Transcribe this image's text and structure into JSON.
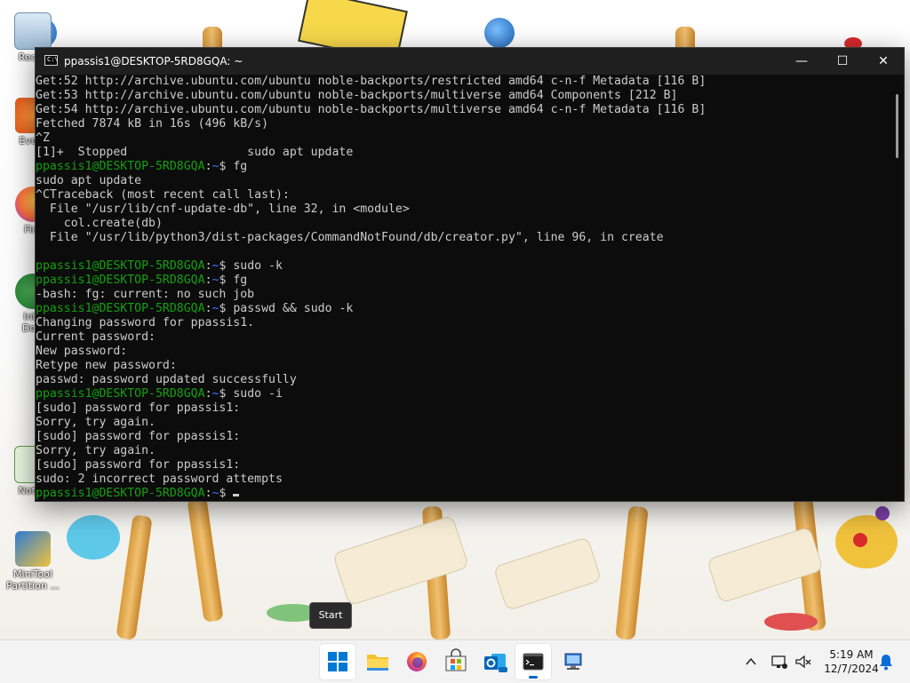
{
  "desktop": {
    "icons": [
      {
        "label": "Recycle Bin",
        "visible_label": "Recyc",
        "icon": "recycle-bin-icon"
      },
      {
        "label": "Everything",
        "visible_label": "Every",
        "icon": "everything-icon"
      },
      {
        "label": "Firefox",
        "visible_label": "Fire",
        "icon": "firefox-icon"
      },
      {
        "label": "Internet Download",
        "visible_label": "Inte\nDow",
        "icon": "internet-download-manager-icon"
      },
      {
        "label": "Notepad",
        "visible_label": "Notep",
        "icon": "notepad-icon"
      },
      {
        "label": "MiniTool Partition ...",
        "visible_label": "MiniTool\nPartition ...",
        "icon": "minitool-partition-icon"
      }
    ]
  },
  "window": {
    "title": "ppassis1@DESKTOP-5RD8GQA: ~",
    "buttons": {
      "minimize": "—",
      "maximize": "☐",
      "close": "✕"
    }
  },
  "terminal": {
    "user": "ppassis1@DESKTOP-5RD8GQA",
    "path": "~",
    "lines": [
      {
        "type": "text",
        "text": "Get:52 http://archive.ubuntu.com/ubuntu noble-backports/restricted amd64 c-n-f Metadata [116 B]"
      },
      {
        "type": "text",
        "text": "Get:53 http://archive.ubuntu.com/ubuntu noble-backports/multiverse amd64 Components [212 B]"
      },
      {
        "type": "text",
        "text": "Get:54 http://archive.ubuntu.com/ubuntu noble-backports/multiverse amd64 c-n-f Metadata [116 B]"
      },
      {
        "type": "text",
        "text": "Fetched 7874 kB in 16s (496 kB/s)"
      },
      {
        "type": "text",
        "text": "^Z"
      },
      {
        "type": "text",
        "text": "[1]+  Stopped                 sudo apt update"
      },
      {
        "type": "prompt",
        "cmd": "fg"
      },
      {
        "type": "text",
        "text": "sudo apt update"
      },
      {
        "type": "text",
        "text": "^CTraceback (most recent call last):"
      },
      {
        "type": "text",
        "text": "  File \"/usr/lib/cnf-update-db\", line 32, in <module>"
      },
      {
        "type": "text",
        "text": "    col.create(db)"
      },
      {
        "type": "text",
        "text": "  File \"/usr/lib/python3/dist-packages/CommandNotFound/db/creator.py\", line 96, in create"
      },
      {
        "type": "text",
        "text": ""
      },
      {
        "type": "prompt",
        "cmd": "sudo -k"
      },
      {
        "type": "prompt",
        "cmd": "fg"
      },
      {
        "type": "text",
        "text": "-bash: fg: current: no such job"
      },
      {
        "type": "prompt",
        "cmd": "passwd && sudo -k"
      },
      {
        "type": "text",
        "text": "Changing password for ppassis1."
      },
      {
        "type": "text",
        "text": "Current password:"
      },
      {
        "type": "text",
        "text": "New password:"
      },
      {
        "type": "text",
        "text": "Retype new password:"
      },
      {
        "type": "text",
        "text": "passwd: password updated successfully"
      },
      {
        "type": "prompt",
        "cmd": "sudo -i"
      },
      {
        "type": "text",
        "text": "[sudo] password for ppassis1:"
      },
      {
        "type": "text",
        "text": "Sorry, try again."
      },
      {
        "type": "text",
        "text": "[sudo] password for ppassis1:"
      },
      {
        "type": "text",
        "text": "Sorry, try again."
      },
      {
        "type": "text",
        "text": "[sudo] password for ppassis1:"
      },
      {
        "type": "text",
        "text": "sudo: 2 incorrect password attempts"
      },
      {
        "type": "prompt",
        "cmd": "",
        "cursor": true
      }
    ]
  },
  "tooltip": {
    "text": "Start"
  },
  "taskbar": {
    "items": [
      {
        "name": "start-button",
        "icon": "windows-logo-icon"
      },
      {
        "name": "file-explorer-button",
        "icon": "folder-icon"
      },
      {
        "name": "firefox-button",
        "icon": "firefox-icon"
      },
      {
        "name": "microsoft-store-button",
        "icon": "store-icon"
      },
      {
        "name": "outlook-new-button",
        "icon": "outlook-icon"
      },
      {
        "name": "terminal-button",
        "icon": "terminal-icon",
        "active": true
      },
      {
        "name": "remote-desktop-button",
        "icon": "remote-desktop-icon"
      }
    ],
    "tray": {
      "chevron": "^"
    },
    "clock": {
      "time": "5:19 AM",
      "date": "12/7/2024"
    }
  }
}
